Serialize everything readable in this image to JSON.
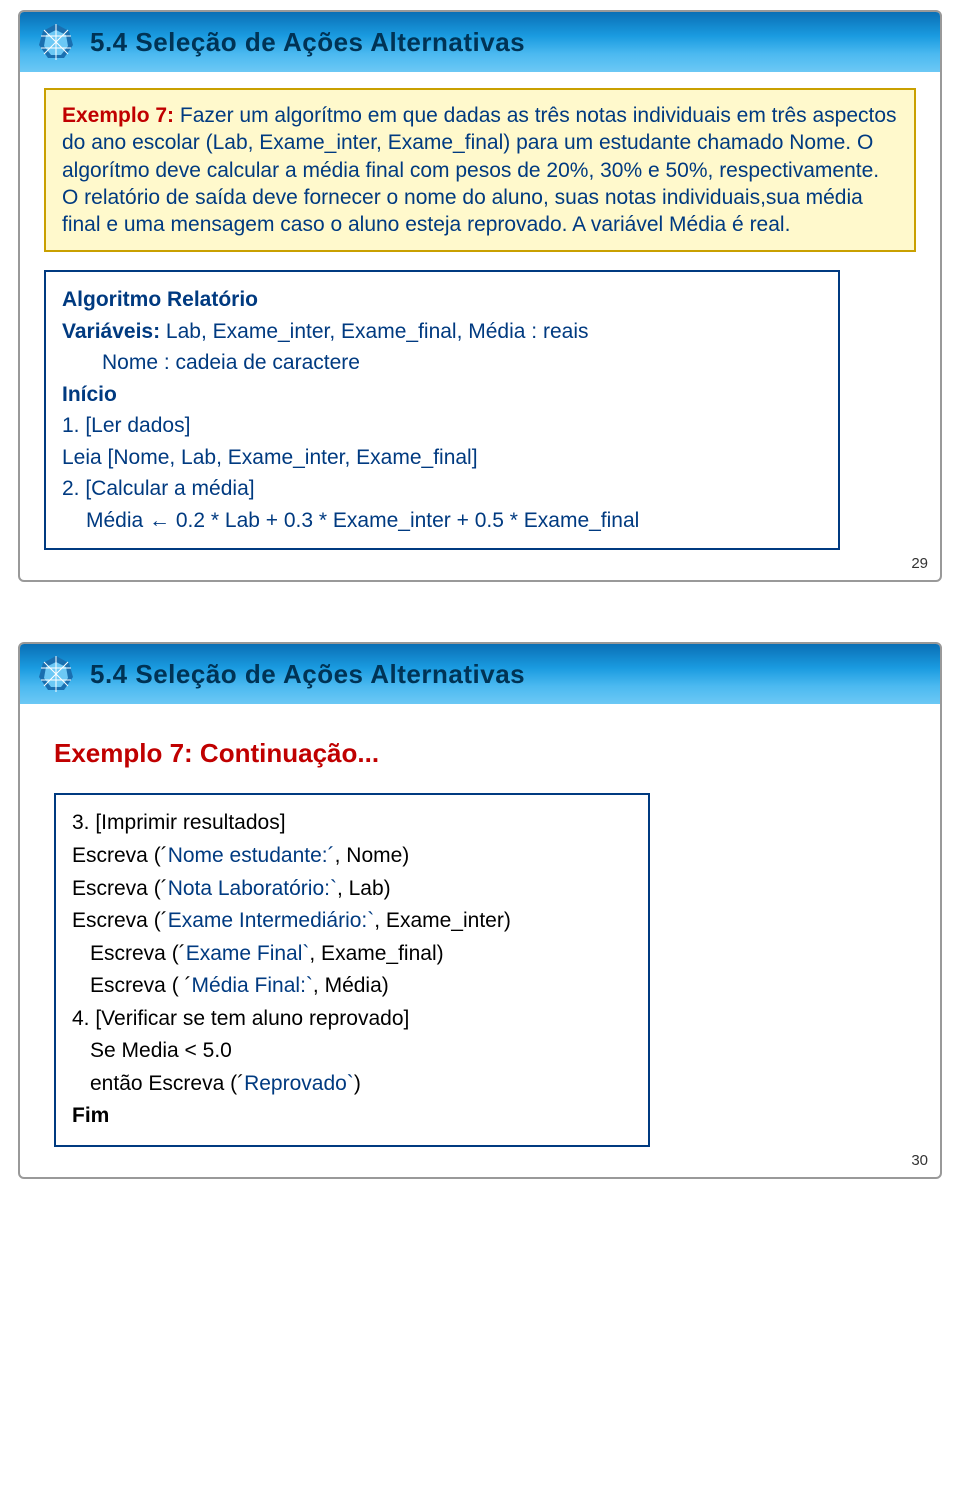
{
  "slide1": {
    "header": "5.4 Seleção de Ações Alternativas",
    "problem": {
      "label": "Exemplo 7:",
      "text1": " Fazer um algorítmo em que dadas as três notas individuais em três aspectos do ano escolar (Lab, Exame_inter, Exame_final) para um estudante chamado Nome. O algorítmo deve calcular a média final com pesos de 20%, 30% e 50%, respectivamente. O relatório de saída deve fornecer o nome do aluno, suas notas individuais,sua média final e uma mensagem caso o aluno esteja reprovado. A variável Média é real."
    },
    "algo": {
      "l1a": "Algoritmo Relatório",
      "l2a": "Variáveis:",
      "l2b": "  Lab, Exame_inter, Exame_final, Média : reais",
      "l3": "Nome : cadeia de caractere",
      "l4": "Início",
      "l5": "1. [Ler dados]",
      "l6": "Leia [Nome, Lab, Exame_inter, Exame_final]",
      "l7": "2. [Calcular a média]",
      "l8": "Média ← 0.2 * Lab + 0.3 * Exame_inter +  0.5 * Exame_final"
    },
    "pagenum": "29"
  },
  "slide2": {
    "header": "5.4 Seleção de Ações Alternativas",
    "title": "Exemplo 7: Continuação...",
    "algo": {
      "l1": "3. [Imprimir resultados]",
      "l2a": "Escreva (´",
      "l2b": "Nome estudante:´",
      "l2c": ", Nome)",
      "l3a": "Escreva (´",
      "l3b": "Nota Laboratório:`",
      "l3c": ", Lab)",
      "l4a": "Escreva (´",
      "l4b": "Exame Intermediário:`",
      "l4c": ", Exame_inter)",
      "l5a": "Escreva (´",
      "l5b": "Exame Final`",
      "l5c": ", Exame_final)",
      "l6a": "Escreva ( ´",
      "l6b": "Média Final:`",
      "l6c": ", Média)",
      "l7": "4. [Verificar se tem aluno reprovado]",
      "l8": "Se Media < 5.0",
      "l9a": "então Escreva (´",
      "l9b": "Reprovado`",
      "l9c": ")",
      "l10": "Fim"
    },
    "pagenum": "30"
  }
}
